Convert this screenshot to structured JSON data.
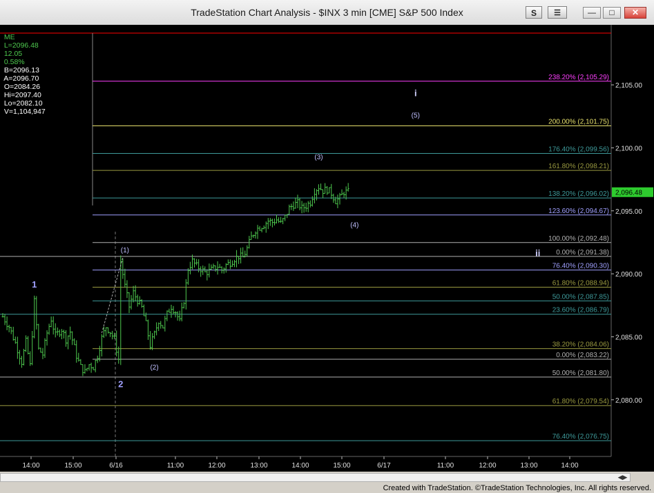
{
  "window": {
    "title": "TradeStation Chart Analysis - $INX 3 min [CME] S&P 500 Index",
    "s_button": "S",
    "toolbar_button": "☰",
    "minimize": "—",
    "maximize": "□",
    "close": "✕",
    "footer": "Created with TradeStation. ©TradeStation Technologies, Inc. All rights reserved."
  },
  "status_bar": {
    "symbol": "ME",
    "last": "L=2096.48",
    "change": "12.05",
    "change_pct": "0.58%",
    "bid": "B=2096.13",
    "ask": "A=2096.70",
    "open": "O=2084.26",
    "high": "Hi=2097.40",
    "low": "Lo=2082.10",
    "volume": "V=1,104,947"
  },
  "colors": {
    "background": "#000000",
    "bars": "#4ec94e",
    "price_line": "#ff0000",
    "last_price_tag": "#2ecc2e",
    "fib_purple": "#ff40ff",
    "fib_yellow": "#e6e06c",
    "fib_teal": "#3e9a9a",
    "fib_olive": "#9a9a40",
    "fib_lavender": "#a0a0ff",
    "fib_gray": "#b0b0b0"
  },
  "chart_data": {
    "type": "ohlc",
    "symbol": "$INX",
    "interval": "3 min",
    "title": "TradeStation Chart Analysis - $INX 3 min [CME] S&P 500 Index",
    "ylim": [
      2075.5,
      2109.0
    ],
    "y_ticks": [
      2080.0,
      2085.0,
      2090.0,
      2095.0,
      2100.0,
      2105.0
    ],
    "y_tick_labels": [
      "2,080.00",
      "2,085.00",
      "2,090.00",
      "2,095.00",
      "2,100.00",
      "2,105.00"
    ],
    "x_tick_labels": [
      "14:00",
      "15:00",
      "6/16",
      "11:00",
      "12:00",
      "13:00",
      "14:00",
      "15:00",
      "6/17",
      "11:00",
      "12:00",
      "13:00",
      "14:00"
    ],
    "last_price": 2096.48,
    "last_price_label": "2,096.48",
    "price_path": [
      [
        0,
        2086.6
      ],
      [
        3,
        2085.8
      ],
      [
        6,
        2084.5
      ],
      [
        9,
        2083.0
      ],
      [
        11,
        2084.6
      ],
      [
        13,
        2082.7
      ],
      [
        15,
        2087.8
      ],
      [
        17,
        2084.0
      ],
      [
        19,
        2083.6
      ],
      [
        21,
        2085.3
      ],
      [
        23,
        2086.4
      ],
      [
        25,
        2085.1
      ],
      [
        28,
        2085.6
      ],
      [
        30,
        2084.8
      ],
      [
        32,
        2085.4
      ],
      [
        35,
        2083.5
      ],
      [
        37,
        2082.6
      ],
      [
        39,
        2082.2
      ],
      [
        41,
        2082.8
      ],
      [
        43,
        2082.6
      ],
      [
        45,
        2083.5
      ],
      [
        47,
        2084.9
      ],
      [
        49,
        2085.8
      ],
      [
        51,
        2085.4
      ],
      [
        53,
        2084.8
      ],
      [
        55,
        2083.2
      ],
      [
        56,
        2091.0
      ],
      [
        58,
        2089.0
      ],
      [
        60,
        2087.4
      ],
      [
        62,
        2088.5
      ],
      [
        64,
        2087.9
      ],
      [
        66,
        2087.3
      ],
      [
        68,
        2086.0
      ],
      [
        70,
        2084.3
      ],
      [
        72,
        2085.2
      ],
      [
        74,
        2086.3
      ],
      [
        76,
        2085.8
      ],
      [
        78,
        2086.8
      ],
      [
        80,
        2087.4
      ],
      [
        82,
        2087.0
      ],
      [
        84,
        2086.2
      ],
      [
        86,
        2087.9
      ],
      [
        88,
        2090.4
      ],
      [
        90,
        2091.0
      ],
      [
        92,
        2090.6
      ],
      [
        94,
        2090.4
      ],
      [
        96,
        2090.1
      ],
      [
        98,
        2090.2
      ],
      [
        100,
        2090.4
      ],
      [
        102,
        2090.6
      ],
      [
        104,
        2090.3
      ],
      [
        106,
        2090.7
      ],
      [
        108,
        2090.9
      ],
      [
        110,
        2091.2
      ],
      [
        112,
        2091.4
      ],
      [
        114,
        2091.3
      ],
      [
        116,
        2092.0
      ],
      [
        118,
        2092.9
      ],
      [
        120,
        2093.5
      ],
      [
        122,
        2093.7
      ],
      [
        124,
        2093.9
      ],
      [
        126,
        2094.2
      ],
      [
        128,
        2094.1
      ],
      [
        130,
        2094.3
      ],
      [
        132,
        2094.0
      ],
      [
        134,
        2094.5
      ],
      [
        136,
        2095.2
      ],
      [
        138,
        2095.5
      ],
      [
        140,
        2095.6
      ],
      [
        142,
        2095.2
      ],
      [
        144,
        2095.4
      ],
      [
        146,
        2095.7
      ],
      [
        148,
        2096.6
      ],
      [
        150,
        2096.9
      ],
      [
        152,
        2096.6
      ],
      [
        154,
        2096.7
      ],
      [
        156,
        2096.4
      ],
      [
        158,
        2095.8
      ],
      [
        160,
        2096.0
      ],
      [
        162,
        2096.5
      ],
      [
        164,
        2096.48
      ]
    ],
    "fib_upper": [
      {
        "label": "238.20% (2,105.29)",
        "value": 2105.29,
        "color": "#ff40ff"
      },
      {
        "label": "200.00% (2,101.75)",
        "value": 2101.75,
        "color": "#e6e06c"
      },
      {
        "label": "176.40% (2,099.56)",
        "value": 2099.56,
        "color": "#3e9a9a"
      },
      {
        "label": "161.80% (2,098.21)",
        "value": 2098.21,
        "color": "#9a9a40"
      },
      {
        "label": "138.20% (2,096.02)",
        "value": 2096.02,
        "color": "#3e9a9a"
      },
      {
        "label": "123.60% (2,094.67)",
        "value": 2094.67,
        "color": "#a0a0ff"
      },
      {
        "label": "100.00% (2,092.48)",
        "value": 2092.48,
        "color": "#b0b0b0"
      },
      {
        "label": "76.40% (2,090.30)",
        "value": 2090.3,
        "color": "#a0a0ff"
      },
      {
        "label": "61.80% (2,088.94)",
        "value": 2088.94,
        "color": "#9a9a40"
      },
      {
        "label": "50.00% (2,087.85)",
        "value": 2087.85,
        "color": "#3e9a9a"
      },
      {
        "label": "38.20% (2,084.06)",
        "value": 2084.06,
        "color": "#9a9a40"
      },
      {
        "label": "0.00% (2,083.22)",
        "value": 2083.22,
        "color": "#b0b0b0"
      }
    ],
    "fib_lower": [
      {
        "label": "0.00% (2,091.38)",
        "value": 2091.38,
        "color": "#b0b0b0"
      },
      {
        "label": "23.60% (2,086.79)",
        "value": 2086.79,
        "color": "#3e9a9a"
      },
      {
        "label": "50.00% (2,081.80)",
        "value": 2081.8,
        "color": "#b0b0b0"
      },
      {
        "label": "61.80% (2,079.54)",
        "value": 2079.54,
        "color": "#9a9a40"
      },
      {
        "label": "76.40% (2,076.75)",
        "value": 2076.75,
        "color": "#3e9a9a"
      }
    ],
    "wave_labels": [
      {
        "text": "1",
        "bar": 15,
        "price": 2088.9,
        "color": "#a0a0ff"
      },
      {
        "text": "2",
        "bar": 56,
        "price": 2081.0,
        "color": "#a0a0ff"
      },
      {
        "text": "(1)",
        "bar": 58,
        "price": 2091.7,
        "color": "#c0c0ff"
      },
      {
        "text": "(2)",
        "bar": 72,
        "price": 2082.4,
        "color": "#c0c0ff"
      },
      {
        "text": "(3)",
        "bar": 150,
        "price": 2099.1,
        "color": "#c0c0ff"
      },
      {
        "text": "(4)",
        "bar": 167,
        "price": 2093.7,
        "color": "#c0c0ff"
      },
      {
        "text": "(5)",
        "bar": 196,
        "price": 2102.4,
        "color": "#c0c0ff"
      },
      {
        "text": "i",
        "bar": 196,
        "price": 2104.1,
        "color": "#d0d0ff"
      },
      {
        "text": "ii",
        "bar": 254,
        "price": 2091.4,
        "color": "#d0d0ff"
      }
    ]
  }
}
